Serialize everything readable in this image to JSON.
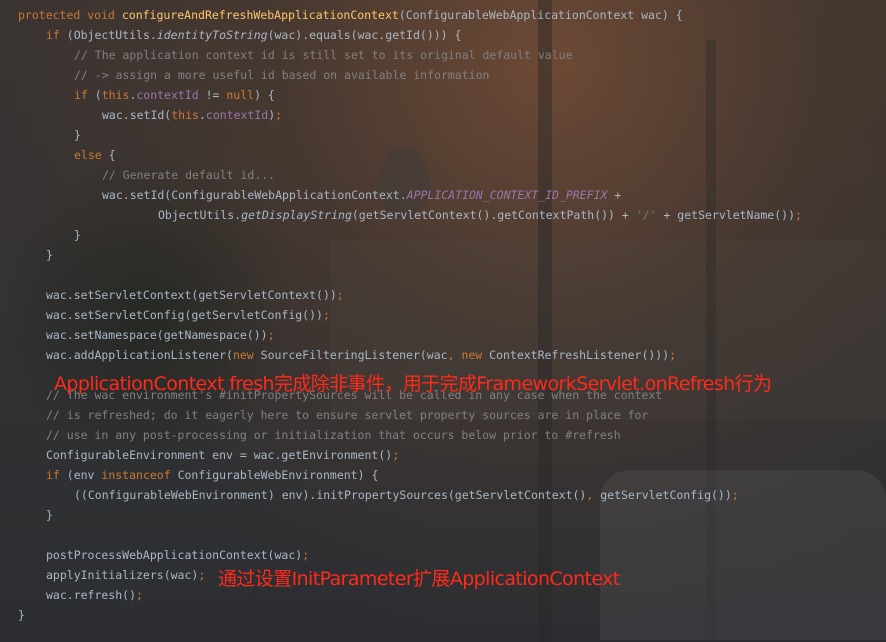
{
  "code_lines": [
    {
      "indent": 0,
      "tokens": [
        {
          "t": "protected void ",
          "c": "kw"
        },
        {
          "t": "configureAndRefreshWebApplicationContext",
          "c": "fn"
        },
        {
          "t": "(ConfigurableWebApplicationContext wac) {",
          "c": "tx"
        }
      ]
    },
    {
      "indent": 1,
      "tokens": [
        {
          "t": "if ",
          "c": "kw"
        },
        {
          "t": "(ObjectUtils.",
          "c": "tx"
        },
        {
          "t": "identityToString",
          "c": "st"
        },
        {
          "t": "(wac).equals(wac.getId())) {",
          "c": "tx"
        }
      ]
    },
    {
      "indent": 2,
      "tokens": [
        {
          "t": "// The application context id is still set to its original default value",
          "c": "cm"
        }
      ]
    },
    {
      "indent": 2,
      "tokens": [
        {
          "t": "// -> assign a more useful id based on available information",
          "c": "cm"
        }
      ]
    },
    {
      "indent": 2,
      "tokens": [
        {
          "t": "if ",
          "c": "kw"
        },
        {
          "t": "(",
          "c": "tx"
        },
        {
          "t": "this",
          "c": "kw"
        },
        {
          "t": ".",
          "c": "tx"
        },
        {
          "t": "contextId",
          "c": "fld"
        },
        {
          "t": " != ",
          "c": "tx"
        },
        {
          "t": "null",
          "c": "kw"
        },
        {
          "t": ") {",
          "c": "tx"
        }
      ]
    },
    {
      "indent": 3,
      "tokens": [
        {
          "t": "wac.setId(",
          "c": "tx"
        },
        {
          "t": "this",
          "c": "kw"
        },
        {
          "t": ".",
          "c": "tx"
        },
        {
          "t": "contextId",
          "c": "fld"
        },
        {
          "t": ")",
          "c": "tx"
        },
        {
          "t": ";",
          "c": "kw"
        }
      ]
    },
    {
      "indent": 2,
      "tokens": [
        {
          "t": "}",
          "c": "tx"
        }
      ]
    },
    {
      "indent": 2,
      "tokens": [
        {
          "t": "else ",
          "c": "kw"
        },
        {
          "t": "{",
          "c": "tx"
        }
      ]
    },
    {
      "indent": 3,
      "tokens": [
        {
          "t": "// Generate default id...",
          "c": "cm"
        }
      ]
    },
    {
      "indent": 3,
      "tokens": [
        {
          "t": "wac.setId(ConfigurableWebApplicationContext.",
          "c": "tx"
        },
        {
          "t": "APPLICATION_CONTEXT_ID_PREFIX",
          "c": "cst"
        },
        {
          "t": " +",
          "c": "tx"
        }
      ]
    },
    {
      "indent": 5,
      "tokens": [
        {
          "t": "ObjectUtils.",
          "c": "tx"
        },
        {
          "t": "getDisplayString",
          "c": "st"
        },
        {
          "t": "(getServletContext().getContextPath()) + ",
          "c": "tx"
        },
        {
          "t": "'/'",
          "c": "str"
        },
        {
          "t": " + getServletName())",
          "c": "tx"
        },
        {
          "t": ";",
          "c": "kw"
        }
      ]
    },
    {
      "indent": 2,
      "tokens": [
        {
          "t": "}",
          "c": "tx"
        }
      ]
    },
    {
      "indent": 1,
      "tokens": [
        {
          "t": "}",
          "c": "tx"
        }
      ]
    },
    {
      "indent": 0,
      "tokens": []
    },
    {
      "indent": 1,
      "tokens": [
        {
          "t": "wac.setServletContext(getServletContext())",
          "c": "tx"
        },
        {
          "t": ";",
          "c": "kw"
        }
      ]
    },
    {
      "indent": 1,
      "tokens": [
        {
          "t": "wac.setServletConfig(getServletConfig())",
          "c": "tx"
        },
        {
          "t": ";",
          "c": "kw"
        }
      ]
    },
    {
      "indent": 1,
      "tokens": [
        {
          "t": "wac.setNamespace(getNamespace())",
          "c": "tx"
        },
        {
          "t": ";",
          "c": "kw"
        }
      ]
    },
    {
      "indent": 1,
      "tokens": [
        {
          "t": "wac.addApplicationListener(",
          "c": "tx"
        },
        {
          "t": "new ",
          "c": "kw"
        },
        {
          "t": "SourceFilteringListener(wac",
          "c": "tx"
        },
        {
          "t": ", ",
          "c": "kw"
        },
        {
          "t": "new ",
          "c": "kw"
        },
        {
          "t": "ContextRefreshListener()))",
          "c": "tx"
        },
        {
          "t": ";",
          "c": "kw"
        }
      ]
    },
    {
      "indent": 0,
      "tokens": []
    },
    {
      "indent": 1,
      "tokens": [
        {
          "t": "// The wac environment's #initPropertySources will be called in any case when the context",
          "c": "cm"
        }
      ]
    },
    {
      "indent": 1,
      "tokens": [
        {
          "t": "// is refreshed; do it eagerly here to ensure servlet property sources are in place for",
          "c": "cm"
        }
      ]
    },
    {
      "indent": 1,
      "tokens": [
        {
          "t": "// use in any post-processing or initialization that occurs below prior to #refresh",
          "c": "cm"
        }
      ]
    },
    {
      "indent": 1,
      "tokens": [
        {
          "t": "ConfigurableEnvironment env = wac.getEnvironment()",
          "c": "tx"
        },
        {
          "t": ";",
          "c": "kw"
        }
      ]
    },
    {
      "indent": 1,
      "tokens": [
        {
          "t": "if ",
          "c": "kw"
        },
        {
          "t": "(env ",
          "c": "tx"
        },
        {
          "t": "instanceof ",
          "c": "kw"
        },
        {
          "t": "ConfigurableWebEnvironment) {",
          "c": "tx"
        }
      ]
    },
    {
      "indent": 2,
      "tokens": [
        {
          "t": "((ConfigurableWebEnvironment) env).initPropertySources(getServletContext()",
          "c": "tx"
        },
        {
          "t": ", ",
          "c": "kw"
        },
        {
          "t": "getServletConfig())",
          "c": "tx"
        },
        {
          "t": ";",
          "c": "kw"
        }
      ]
    },
    {
      "indent": 1,
      "tokens": [
        {
          "t": "}",
          "c": "tx"
        }
      ]
    },
    {
      "indent": 0,
      "tokens": []
    },
    {
      "indent": 1,
      "tokens": [
        {
          "t": "postProcessWebApplicationContext(wac)",
          "c": "tx"
        },
        {
          "t": ";",
          "c": "kw"
        }
      ]
    },
    {
      "indent": 1,
      "tokens": [
        {
          "t": "applyInitializers(wac)",
          "c": "tx"
        },
        {
          "t": ";",
          "c": "kw"
        }
      ]
    },
    {
      "indent": 1,
      "tokens": [
        {
          "t": "wac.refresh()",
          "c": "tx"
        },
        {
          "t": ";",
          "c": "kw"
        }
      ]
    },
    {
      "indent": 0,
      "tokens": [
        {
          "t": "}",
          "c": "tx"
        }
      ]
    }
  ],
  "annotations": {
    "refresh_note": "ApplicationContext fresh完成除非事件，用于完成FrameworkServlet.onRefresh行为",
    "init_param_note": "通过设置InitParameter扩展ApplicationContext"
  },
  "colors": {
    "keyword": "#cc7832",
    "method_declaration": "#ffc66d",
    "comment": "#808080",
    "field": "#9876aa",
    "string": "#6a8759",
    "plain": "#a9b7c6",
    "annotation_red": "#ff2a1a"
  }
}
